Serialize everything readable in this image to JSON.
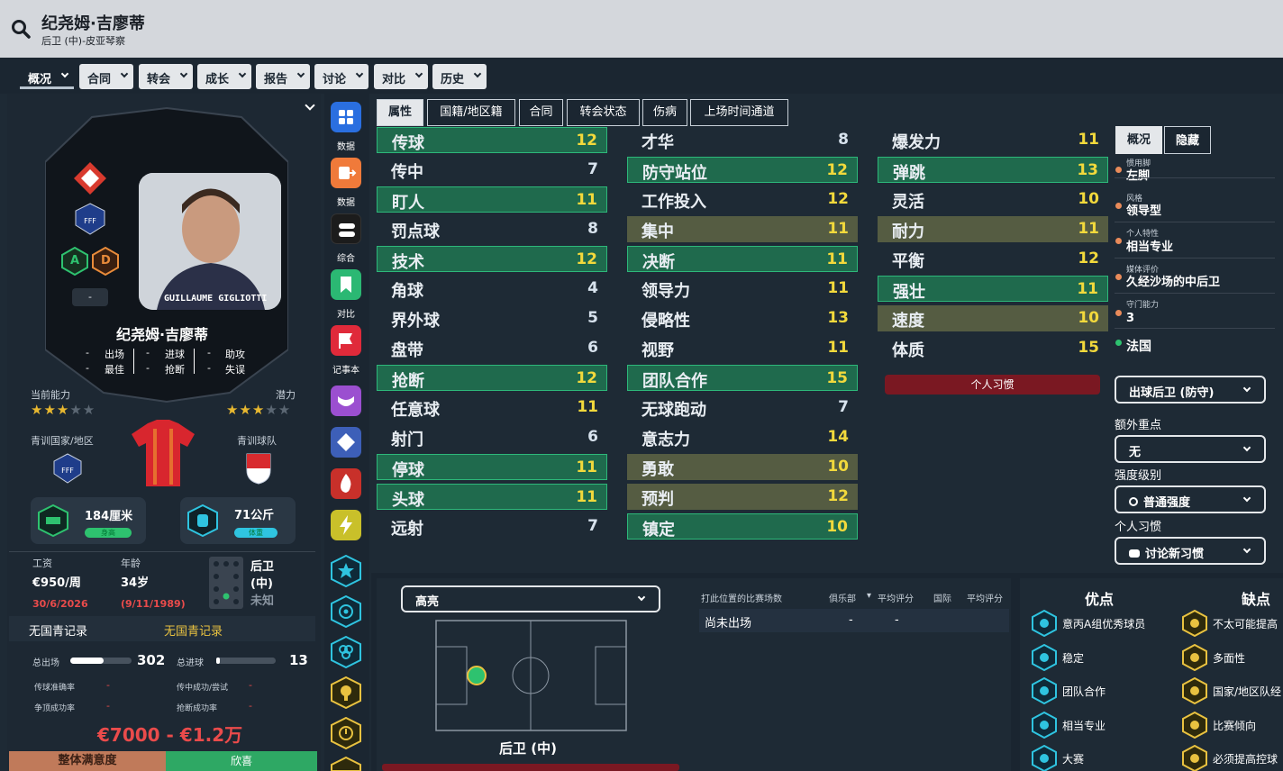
{
  "header": {
    "player_name": "纪尧姆·吉廖蒂",
    "position_club": "后卫 (中)-皮亚琴察"
  },
  "nav": [
    {
      "label": "概况",
      "active": true
    },
    {
      "label": "合同"
    },
    {
      "label": "转会"
    },
    {
      "label": "成长"
    },
    {
      "label": "报告"
    },
    {
      "label": "讨论"
    },
    {
      "label": "对比"
    },
    {
      "label": "历史"
    }
  ],
  "card": {
    "name": "纪尧姆·吉廖蒂",
    "photo_caption": "GUILLAUME GIGLIOTTI",
    "badge_a": "A",
    "badge_d": "D",
    "dash": "-",
    "apps_label": "出场",
    "goals_label": "进球",
    "assists_label": "助攻",
    "best_label": "最佳",
    "tackles_label": "抢断",
    "errors_label": "失误",
    "apps": "-",
    "goals": "-",
    "assists": "-",
    "best": "-",
    "tackles": "-",
    "errors": "-"
  },
  "ability": {
    "current_label": "当前能力",
    "potential_label": "潜力",
    "current_stars": 3,
    "potential_stars": 3,
    "youth_nation_label": "青训国家/地区",
    "youth_club_label": "青训球队"
  },
  "physique": {
    "height": "184厘米",
    "height_tag": "身高",
    "weight": "71公斤",
    "weight_tag": "体重"
  },
  "info": {
    "wage_label": "工资",
    "wage": "€950/周",
    "age_label": "年龄",
    "age": "34岁",
    "contract_end": "30/6/2026",
    "dob": "(9/11/1989)",
    "position": "后卫",
    "position_sub": "(中)",
    "foot": "未知"
  },
  "youth": {
    "left": "无国青记录",
    "right": "无国青记录"
  },
  "career": {
    "apps_label": "总出场",
    "apps": "302",
    "apps_fill": 0.55,
    "goals_label": "总进球",
    "goals": "13",
    "goals_fill": 0.04
  },
  "rates": {
    "pass_label": "传球准确率",
    "pass": "-",
    "cross_label": "传中成功/尝试",
    "cross": "-",
    "header_label": "争顶成功率",
    "header": "-",
    "tackle_label": "抢断成功率",
    "tackle": "-"
  },
  "value": "€7000 - €1.2万",
  "bottom_bar": {
    "left": "整体满意度",
    "right": "欣喜"
  },
  "sidebar": [
    {
      "label": "数据",
      "color": "#2a6fe0",
      "icon": "grid-icon"
    },
    {
      "label": "数据",
      "color": "#f07a3a",
      "icon": "export-icon"
    },
    {
      "label": "综合",
      "color": "#1c1c1c",
      "icon": "layers-icon"
    },
    {
      "label": "对比",
      "color": "#2bb873",
      "icon": "bookmark-icon"
    },
    {
      "label": "记事本",
      "color": "#e02a3a",
      "icon": "flag-icon"
    }
  ],
  "tabs": [
    "属性",
    "国籍/地区籍",
    "合同",
    "转会状态",
    "伤病",
    "上场时间通道"
  ],
  "attributes": {
    "technical": [
      {
        "n": "传球",
        "v": "12",
        "s": "g"
      },
      {
        "n": "传中",
        "v": "7",
        "s": "n"
      },
      {
        "n": "盯人",
        "v": "11",
        "s": "g"
      },
      {
        "n": "罚点球",
        "v": "8",
        "s": "n"
      },
      {
        "n": "技术",
        "v": "12",
        "s": "g"
      },
      {
        "n": "角球",
        "v": "4",
        "s": "n"
      },
      {
        "n": "界外球",
        "v": "5",
        "s": "n"
      },
      {
        "n": "盘带",
        "v": "6",
        "s": "n"
      },
      {
        "n": "抢断",
        "v": "12",
        "s": "g"
      },
      {
        "n": "任意球",
        "v": "11",
        "s": "n"
      },
      {
        "n": "射门",
        "v": "6",
        "s": "n"
      },
      {
        "n": "停球",
        "v": "11",
        "s": "g"
      },
      {
        "n": "头球",
        "v": "11",
        "s": "g"
      },
      {
        "n": "远射",
        "v": "7",
        "s": "n"
      }
    ],
    "mental": [
      {
        "n": "才华",
        "v": "8",
        "s": "n"
      },
      {
        "n": "防守站位",
        "v": "12",
        "s": "g"
      },
      {
        "n": "工作投入",
        "v": "12",
        "s": "n"
      },
      {
        "n": "集中",
        "v": "11",
        "s": "o"
      },
      {
        "n": "决断",
        "v": "11",
        "s": "g"
      },
      {
        "n": "领导力",
        "v": "11",
        "s": "n"
      },
      {
        "n": "侵略性",
        "v": "13",
        "s": "n"
      },
      {
        "n": "视野",
        "v": "11",
        "s": "n"
      },
      {
        "n": "团队合作",
        "v": "15",
        "s": "g"
      },
      {
        "n": "无球跑动",
        "v": "7",
        "s": "n"
      },
      {
        "n": "意志力",
        "v": "14",
        "s": "n"
      },
      {
        "n": "勇敢",
        "v": "10",
        "s": "o"
      },
      {
        "n": "预判",
        "v": "12",
        "s": "o"
      },
      {
        "n": "镇定",
        "v": "10",
        "s": "g"
      }
    ],
    "physical": [
      {
        "n": "爆发力",
        "v": "11",
        "s": "n"
      },
      {
        "n": "弹跳",
        "v": "13",
        "s": "g"
      },
      {
        "n": "灵活",
        "v": "10",
        "s": "n"
      },
      {
        "n": "耐力",
        "v": "11",
        "s": "o"
      },
      {
        "n": "平衡",
        "v": "12",
        "s": "n"
      },
      {
        "n": "强壮",
        "v": "11",
        "s": "g"
      },
      {
        "n": "速度",
        "v": "10",
        "s": "o"
      },
      {
        "n": "体质",
        "v": "15",
        "s": "n"
      }
    ]
  },
  "personal_habits_button": "个人习惯",
  "overview": {
    "tab_on": "概况",
    "tab_off": "隐藏",
    "traits": [
      {
        "label": "惯用脚",
        "value": "左脚"
      },
      {
        "label": "风格",
        "value": "领导型"
      },
      {
        "label": "个人特性",
        "value": "相当专业"
      },
      {
        "label": "媒体评价",
        "value": "久经沙场的中后卫"
      },
      {
        "label": "守门能力",
        "value": "3"
      }
    ],
    "nationality": "法国"
  },
  "roles": {
    "role": "出球后卫 (防守)",
    "extra_label": "额外重点",
    "extra": "无",
    "intensity_label": "强度级别",
    "intensity": "普通强度",
    "habits_label": "个人习惯",
    "habits_btn": "讨论新习惯"
  },
  "pitch": {
    "dropdown": "高亮",
    "position_label": "后卫 (中)"
  },
  "matches": {
    "header": "打此位置的比赛场数",
    "club": "俱乐部",
    "avg1": "平均评分",
    "intl": "国际",
    "avg2": "平均评分",
    "row_label": "尚未出场",
    "club_val": "-",
    "avg_val": "-"
  },
  "strengths": {
    "title": "优点",
    "items": [
      "意丙A组优秀球员",
      "稳定",
      "团队合作",
      "相当专业",
      "大赛"
    ]
  },
  "weaknesses": {
    "title": "缺点",
    "items": [
      "不太可能提高",
      "多面性",
      "国家/地区队经",
      "比赛倾向",
      "必须提高控球"
    ]
  }
}
